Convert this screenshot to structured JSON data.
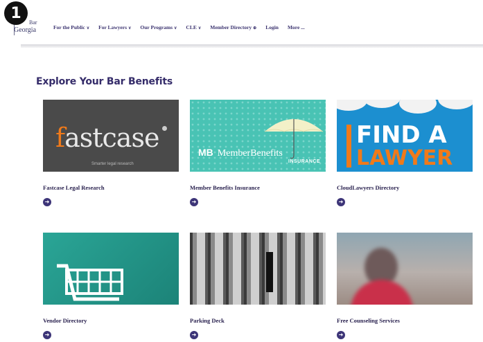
{
  "step_badge": "1",
  "logo": {
    "line1": "Bar",
    "line2": "Georgia"
  },
  "nav": [
    {
      "label": "For the Public",
      "suffix": "∨"
    },
    {
      "label": "For Lawyers",
      "suffix": "∨"
    },
    {
      "label": "Our Programs",
      "suffix": "∨"
    },
    {
      "label": "CLE",
      "suffix": "∨"
    },
    {
      "label": "Member Directory",
      "suffix": "⊕"
    },
    {
      "label": "Login",
      "suffix": ""
    },
    {
      "label": "More ...",
      "suffix": ""
    }
  ],
  "section_title": "Explore Your Bar Benefits",
  "cards": [
    {
      "label": "Fastcase Legal Research",
      "thumb": {
        "word_f": "f",
        "word_rest": "astcase",
        "tagline": "Smarter legal research"
      }
    },
    {
      "label": "Member Benefits Insurance",
      "thumb": {
        "mb": "MB",
        "brand_a": "Member",
        "brand_b": "Benefits",
        "insurance": "INSURANCE"
      }
    },
    {
      "label": "CloudLawyers Directory",
      "thumb": {
        "line1": "FIND A",
        "line2": "LAWYER"
      }
    },
    {
      "label": "Vendor Directory"
    },
    {
      "label": "Parking Deck"
    },
    {
      "label": "Free Counseling Services"
    }
  ],
  "go_icon": "arrow-right-circle-icon",
  "colors": {
    "primary": "#352c6a",
    "orange": "#f07a1a",
    "teal": "#49c3b4",
    "blue": "#1c8fd0"
  }
}
